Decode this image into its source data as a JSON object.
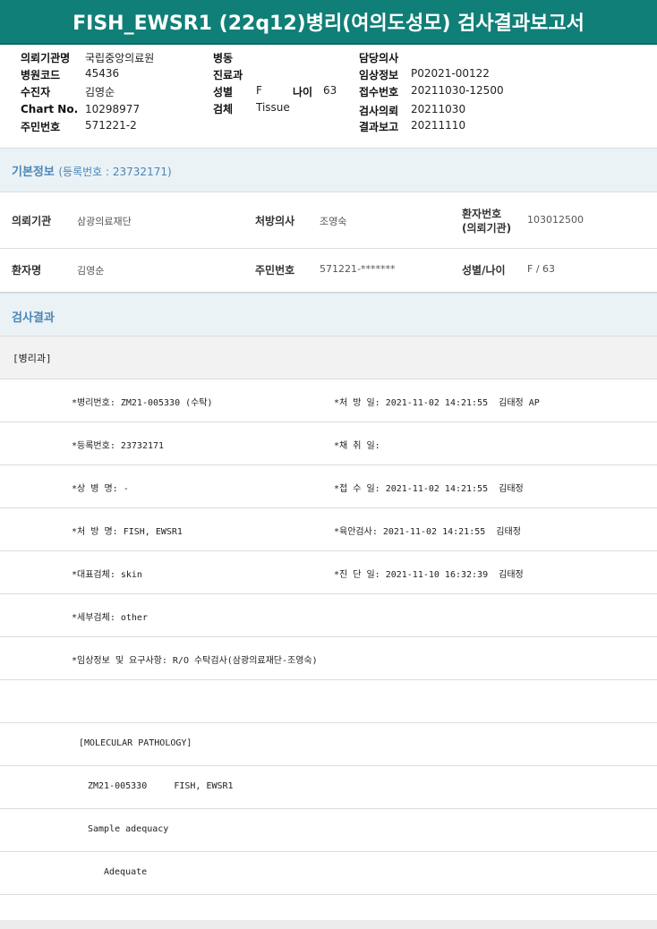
{
  "report_title": "FISH_EWSR1 (22q12)병리(여의도성모) 검사결과보고서",
  "header": {
    "col1": [
      {
        "label": "의뢰기관명",
        "value": "국립중앙의료원"
      },
      {
        "label": "병원코드",
        "value": "45436"
      },
      {
        "label": "수진자",
        "value": "김영순"
      },
      {
        "label": "Chart No.",
        "value": "10298977"
      },
      {
        "label": "주민번호",
        "value": "571221-2"
      }
    ],
    "col2": [
      {
        "label": "병동",
        "value": ""
      },
      {
        "label": "진료과",
        "value": ""
      },
      {
        "label": "성별",
        "value": "F"
      },
      {
        "label": "검체",
        "value": "Tissue"
      }
    ],
    "age_label": "나이",
    "age_value": "63",
    "col3": [
      {
        "label": "담당의사",
        "value": ""
      },
      {
        "label": "임상정보",
        "value": "P02021-00122"
      },
      {
        "label": "접수번호",
        "value": "20211030-12500"
      },
      {
        "label": "검사의뢰",
        "value": "20211030"
      },
      {
        "label": "결과보고",
        "value": "20211110"
      }
    ]
  },
  "basic_info": {
    "title": "기본정보",
    "reg_label": "(등록번호 : 23732171)",
    "rows": [
      [
        {
          "label": "의뢰기관",
          "value": "삼광의료재단"
        },
        {
          "label": "처방의사",
          "value": "조영숙"
        },
        {
          "label_line1": "환자번호",
          "label_line2": "(의뢰기관)",
          "value": "103012500"
        }
      ],
      [
        {
          "label": "환자명",
          "value": "김영순"
        },
        {
          "label": "주민번호",
          "value": "571221-*******"
        },
        {
          "label": "성별/나이",
          "value": "F / 63"
        }
      ]
    ]
  },
  "results": {
    "title": "검사결과",
    "dept": "[병리과]",
    "rows": [
      {
        "left": "*병리번호: ZM21-005330 (수탁)",
        "right": "*처 방 일: 2021-11-02 14:21:55  김태정 AP"
      },
      {
        "left": "*등록번호: 23732171",
        "right": "*채 취 일:"
      },
      {
        "left": "*상 병 명: -",
        "right": "*접 수 일: 2021-11-02 14:21:55  김태정"
      },
      {
        "left": "*처 방 명: FISH, EWSR1",
        "right": "*육안검사: 2021-11-02 14:21:55  김태정"
      },
      {
        "left": "*대표검체: skin",
        "right": "*진 단 일: 2021-11-10 16:32:39  김태정"
      },
      {
        "left": "*세부검체: other",
        "right": ""
      },
      {
        "left": "*임상정보 및 요구사항: R/O 수탁검사(삼광의료재단-조영숙)",
        "right": ""
      },
      {
        "left": "",
        "right": ""
      }
    ],
    "molecular_header": "[MOLECULAR PATHOLOGY]",
    "molecular_line": "ZM21-005330     FISH, EWSR1",
    "adequacy_label": "Sample adequacy",
    "adequacy_value": "Adequate"
  }
}
